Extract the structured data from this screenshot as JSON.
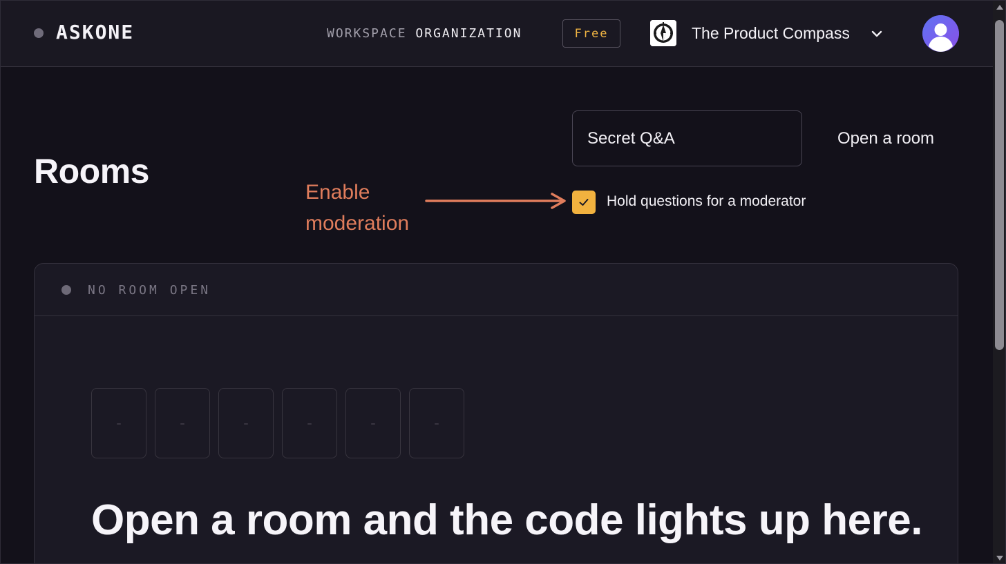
{
  "header": {
    "brand": "ASKONE",
    "workspace_label": "WORKSPACE",
    "workspace_value": "ORGANIZATION",
    "plan": "Free",
    "org_name": "The Product Compass",
    "org_logo_icon": "compass-logo-icon",
    "chevron_icon": "chevron-down-icon",
    "avatar_icon": "user-avatar-icon"
  },
  "page": {
    "title": "Rooms",
    "room_input_value": "Secret Q&A",
    "open_room_label": "Open a room",
    "moderation_checked": true,
    "moderation_label": "Hold questions for a moderator"
  },
  "annotation": {
    "line1": "Enable",
    "line2": "moderation"
  },
  "room_card": {
    "status": "NO ROOM OPEN",
    "code_slots": [
      "-",
      "-",
      "-",
      "-",
      "-",
      "-"
    ],
    "headline": "Open a room and the code lights up here."
  },
  "colors": {
    "background": "#13111a",
    "accent": "#f2b23f",
    "annotation": "#e07d5c",
    "avatar": "#6d5df0"
  }
}
